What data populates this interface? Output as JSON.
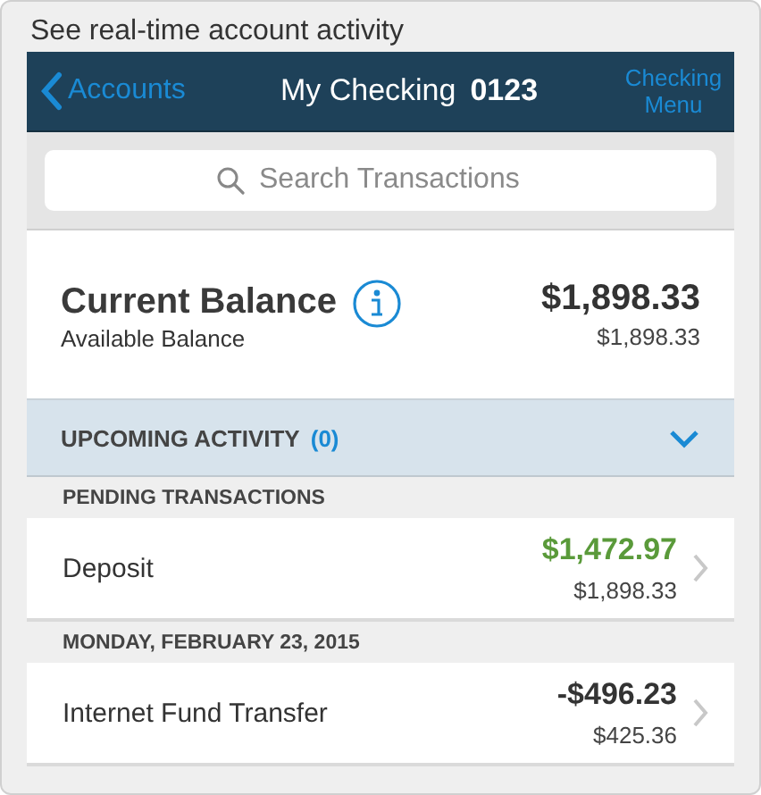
{
  "caption": "See real-time account activity",
  "nav": {
    "back": "Accounts",
    "title": "My Checking",
    "account_number": "0123",
    "menu": "Checking Menu"
  },
  "search": {
    "placeholder": "Search Transactions"
  },
  "balance": {
    "label": "Current Balance",
    "sublabel": "Available Balance",
    "amount": "$1,898.33",
    "available": "$1,898.33"
  },
  "upcoming": {
    "label": "UPCOMING ACTIVITY",
    "count": "(0)",
    "expanded": false
  },
  "sections": [
    {
      "header": "PENDING TRANSACTIONS",
      "transactions": [
        {
          "name": "Deposit",
          "amount": "$1,472.97",
          "balance": "$1,898.33",
          "kind": "credit"
        }
      ]
    },
    {
      "header": "MONDAY, FEBRUARY 23, 2015",
      "transactions": [
        {
          "name": "Internet Fund Transfer",
          "amount": "-$496.23",
          "balance": "$425.36",
          "kind": "debit"
        }
      ]
    }
  ]
}
